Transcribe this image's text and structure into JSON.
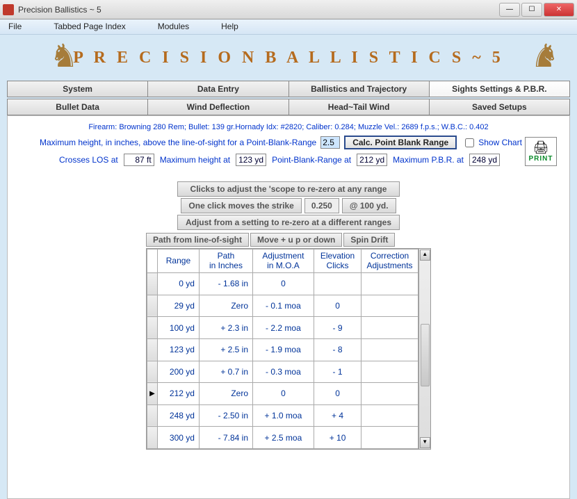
{
  "window": {
    "title": "Precision Ballistics ~ 5"
  },
  "menu": {
    "file": "File",
    "tabbed": "Tabbed Page Index",
    "modules": "Modules",
    "help": "Help"
  },
  "header": {
    "title": "P R E C I S I O N   B A L L I S T I C S  ~  5"
  },
  "tabs1": {
    "system": "System",
    "data": "Data Entry",
    "bt": "Ballistics and Trajectory",
    "sights": "Sights Settings & P.B.R."
  },
  "tabs2": {
    "bullet": "Bullet Data",
    "wind": "Wind Deflection",
    "ht": "Head~Tail Wind",
    "saved": "Saved Setups"
  },
  "firearm_line": "Firearm: Browning 280 Rem;   Bullet: 139 gr.Hornady   Idx: #2820;   Caliber: 0.284;   Muzzle Vel.: 2689 f.p.s.;   W.B.C.: 0.402",
  "pbr": {
    "label_maxh": "Maximum height, in inches, above the line-of-sight for a Point-Blank-Range",
    "maxh_val": "2.5",
    "calc": "Calc. Point Blank Range",
    "showchart": "Show Chart",
    "crosses": "Crosses LOS at",
    "crosses_v": "87 ft",
    "maxhat": "Maximum height at",
    "maxhat_v": "123 yd",
    "pbrat": "Point-Blank-Range at",
    "pbrat_v": "212 yd",
    "maxpbr": "Maximum P.B.R. at",
    "maxpbr_v": "248 yd"
  },
  "print": "PRINT",
  "mid": {
    "b1": "Clicks to adjust the  'scope to re-zero at any range",
    "b2": "One click moves the strike",
    "b2v": "0.250",
    "b2u": "@ 100 yd.",
    "b3": "Adjust from a setting to re-zero at a different ranges",
    "t1": "Path from line-of-sight",
    "t2": "Move  +  u p or down",
    "t3": "Spin Drift"
  },
  "headers": {
    "range": "Range",
    "path": "Path\nin Inches",
    "adj": "Adjustment\nin M.O.A",
    "elev": "Elevation\nClicks",
    "corr": "Correction\nAdjustments"
  },
  "rows": [
    {
      "mark": "",
      "range": "0 yd",
      "path": "- 1.68 in",
      "adj": "0",
      "elev": "",
      "corr": ""
    },
    {
      "mark": "",
      "range": "29 yd",
      "path": "Zero",
      "adj": "- 0.1  moa",
      "elev": "0",
      "corr": ""
    },
    {
      "mark": "",
      "range": "100 yd",
      "path": "+ 2.3 in",
      "adj": "- 2.2  moa",
      "elev": "- 9",
      "corr": ""
    },
    {
      "mark": "",
      "range": "123 yd",
      "path": "+ 2.5 in",
      "adj": "- 1.9  moa",
      "elev": "- 8",
      "corr": ""
    },
    {
      "mark": "",
      "range": "200 yd",
      "path": "+ 0.7 in",
      "adj": "- 0.3  moa",
      "elev": "- 1",
      "corr": ""
    },
    {
      "mark": "▶",
      "range": "212 yd",
      "path": "Zero",
      "adj": "0",
      "elev": "0",
      "corr": ""
    },
    {
      "mark": "",
      "range": "248 yd",
      "path": "- 2.50 in",
      "adj": "+ 1.0  moa",
      "elev": "+ 4",
      "corr": ""
    },
    {
      "mark": "",
      "range": "300 yd",
      "path": "- 7.84 in",
      "adj": "+ 2.5  moa",
      "elev": "+ 10",
      "corr": ""
    }
  ]
}
